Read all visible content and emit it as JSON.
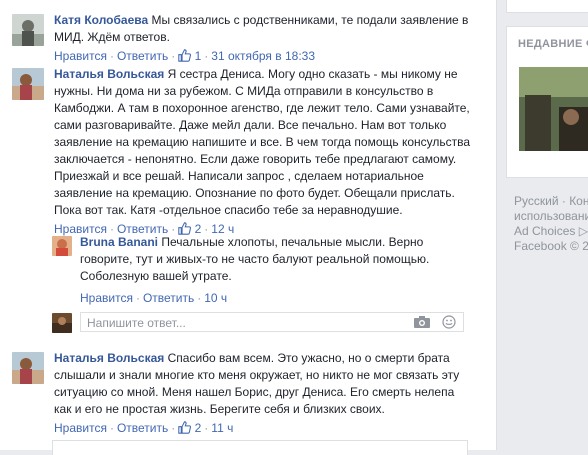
{
  "comments": [
    {
      "author": "Катя Колобаева",
      "text_lines": [
        "Мы связались с родственниками, те подали заявление в",
        "МИД. Ждём ответов."
      ],
      "like_label": "Нравится",
      "reply_label": "Ответить",
      "likes": "1",
      "time": "31 октября в 18:33"
    },
    {
      "author": "Наталья Вольская",
      "text_lines": [
        "Я сестра Дениса. Могу одно сказать - мы никому не",
        "нужны. Ни дома ни за рубежом. С МИДа отправили в консульство в",
        "Камбоджи. А там в похоронное агенство, где лежит тело. Сами узнавайте,",
        "сами разговаривайте. Даже мейл дали. Все печально. Нам вот только",
        "заявление на кремацию напишите и все. В чем тогда помощь консульства",
        "заключается - непонятно. Если даже говорить тебе предлагают самому.",
        "Приезжай и все решай. Написали запрос , сделаем нотариальное",
        "заявление на кремацию. Опознание по фото будет. Обещали прислать.",
        "Пока вот так. Катя -отдельное спасибо тебе за неравнодушие."
      ],
      "like_label": "Нравится",
      "reply_label": "Ответить",
      "likes": "2",
      "time": "12 ч"
    },
    {
      "author": "Наталья Вольская",
      "text_lines": [
        "Спасибо вам всем. Это ужасно, но о смерти брата",
        "слышали и знали многие кто меня окружает, но никто не мог связать эту",
        "ситуацию со мной. Меня нашел Борис, друг Дениса. Его смерть нелепа",
        "как и его не простая жизнь. Берегите себя и близких своих."
      ],
      "like_label": "Нравится",
      "reply_label": "Ответить",
      "likes": "2",
      "time": "11 ч"
    }
  ],
  "reply": {
    "author": "Bruna Banani",
    "text_lines": [
      "Печальные хлопоты, печальные мысли. Верно",
      "говорите, тут и живых-то не часто балуют реальной помощью.",
      "Соболезную вашей утрате."
    ],
    "like_label": "Нравится",
    "reply_label": "Ответить",
    "time": "10 ч"
  },
  "reply_input": {
    "placeholder": "Напишите ответ..."
  },
  "rail": {
    "panel_title": "НЕДАВНИЕ Ф",
    "footer_lines": [
      "Русский · Кон",
      "использовани",
      "Ad Choices ▷",
      "Facebook © 2"
    ]
  },
  "colors": {
    "link": "#365899",
    "action": "#4267b2",
    "muted": "#90949c",
    "background": "#e9ebee"
  }
}
